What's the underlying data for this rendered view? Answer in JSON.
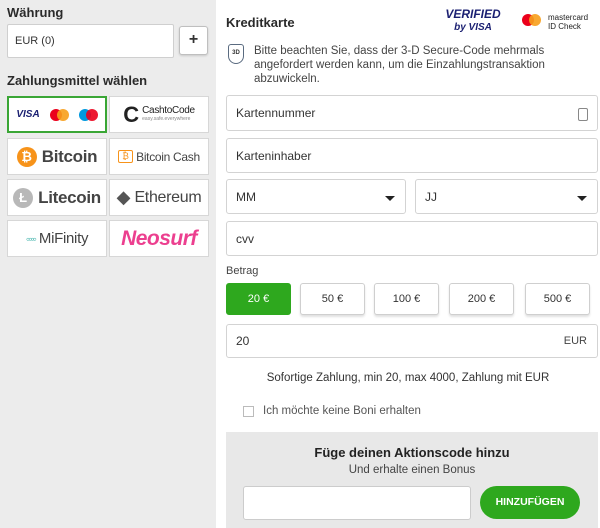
{
  "currency": {
    "title": "Währung",
    "value": "EUR (0)",
    "add_label": "+"
  },
  "payment_methods": {
    "title": "Zahlungsmittel wählen",
    "items": [
      {
        "name": "Visa / Mastercard / Maestro",
        "visa_text": "VISA",
        "selected": true
      },
      {
        "name": "CashtoCode",
        "label": "CashtoCode",
        "tagline": "easy.safe.everywhere"
      },
      {
        "name": "Bitcoin",
        "label": "Bitcoin",
        "icon": "₿",
        "color": "#f7931a"
      },
      {
        "name": "Bitcoin Cash",
        "label": "Bitcoin Cash",
        "icon": "₿",
        "color": "#f7931a"
      },
      {
        "name": "Litecoin",
        "label": "Litecoin",
        "icon": "Ł",
        "color": "#b8b8b8"
      },
      {
        "name": "Ethereum",
        "label": "Ethereum",
        "icon": "◆",
        "color": "#555555"
      },
      {
        "name": "MiFinity",
        "label": "MiFinity"
      },
      {
        "name": "Neosurf",
        "label": "Neosurf",
        "color": "#ec3f8f"
      }
    ]
  },
  "card": {
    "title": "Kreditkarte",
    "verified_line1": "VERIFIED",
    "verified_line2": "by VISA",
    "mc_line1": "mastercard",
    "mc_line2": "ID Check",
    "secure_badge": "3D",
    "info": "Bitte beachten Sie, dass der 3-D Secure-Code mehrmals angefordert werden kann, um die Einzahlungstransaktion abzuwickeln.",
    "card_number_placeholder": "Kartennummer",
    "holder_placeholder": "Karteninhaber",
    "month_value": "MM",
    "year_value": "JJ",
    "cvv_placeholder": "cvv"
  },
  "amount": {
    "label": "Betrag",
    "options": [
      "20 €",
      "50 €",
      "100 €",
      "200 €",
      "500 €"
    ],
    "selected_index": 0,
    "value": "20",
    "currency": "EUR",
    "note": "Sofortige Zahlung, min 20, max 4000, Zahlung mit EUR"
  },
  "bonus": {
    "checkbox_label": "Ich möchte keine Boni erhalten"
  },
  "promo": {
    "title": "Füge deinen Aktionscode hinzu",
    "subtitle": "Und erhalte einen Bonus",
    "button_label": "HINZUFÜGEN"
  },
  "colors": {
    "accent_green": "#2ea81e",
    "neosurf_pink": "#ec3f8f",
    "bitcoin_orange": "#f7931a"
  }
}
